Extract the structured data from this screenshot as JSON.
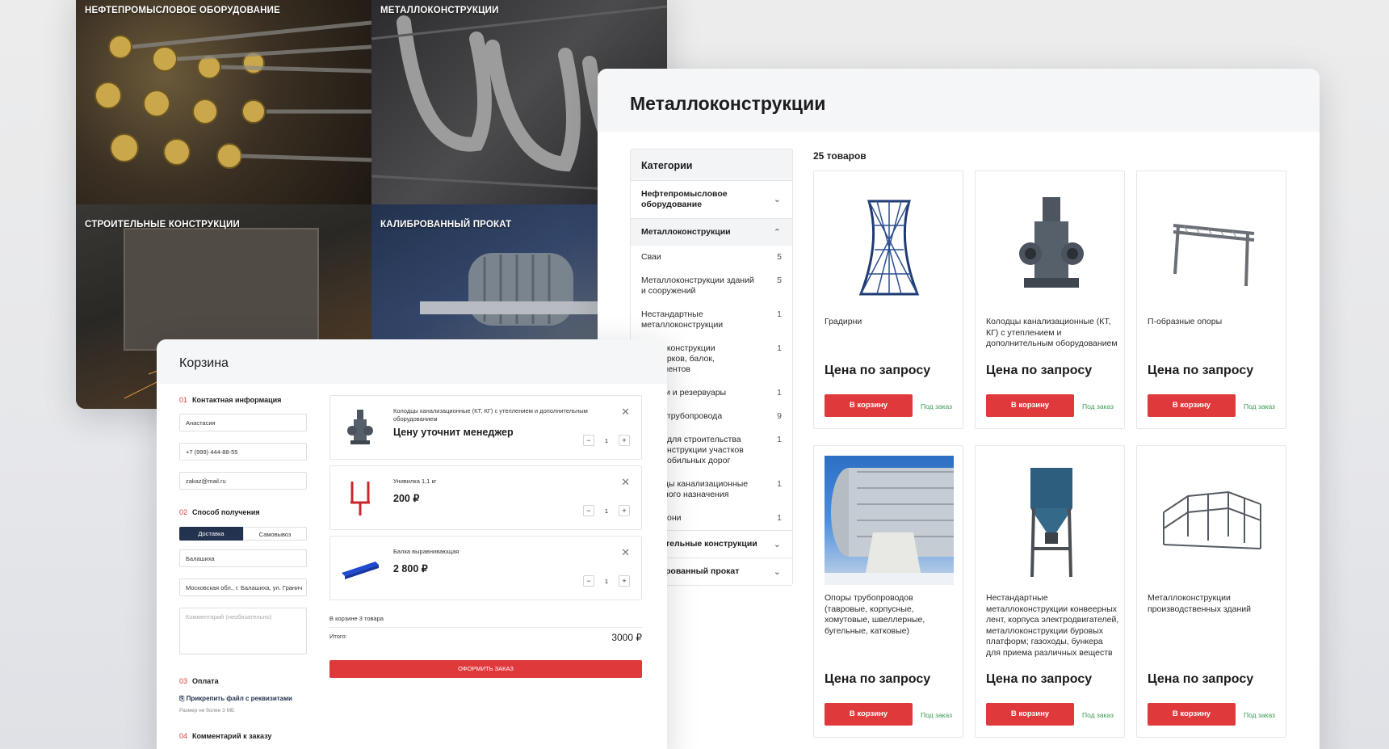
{
  "colors": {
    "accent": "#e0393b",
    "navy": "#23324f",
    "green": "#3a9a52"
  },
  "tiles": [
    {
      "label": "НЕФТЕПРОМЫСЛОВОЕ ОБОРУДОВАНИЕ"
    },
    {
      "label": "МЕТАЛЛОКОНСТРУКЦИИ"
    },
    {
      "label": "СТРОИТЕЛЬНЫЕ КОНСТРУКЦИИ"
    },
    {
      "label": "КАЛИБРОВАННЫЙ ПРОКАТ"
    }
  ],
  "catalog": {
    "title": "Металлоконструкции",
    "sidebar_title": "Категории",
    "groups": [
      {
        "label": "Нефтепромысловое оборудование",
        "icon": "chevron-down-icon"
      },
      {
        "label": "Металлоконструкции",
        "icon": "chevron-up-icon"
      },
      {
        "label": "тельные конструкции",
        "icon": "chevron-down-icon"
      },
      {
        "label": "рованный прокат",
        "icon": "chevron-down-icon"
      }
    ],
    "subs": [
      {
        "label": "Сваи",
        "count": "5"
      },
      {
        "label": "Металлоконструкции зданий и сооружений",
        "count": "5"
      },
      {
        "label": "Нестандартные металлоконструкции",
        "count": "1"
      },
      {
        "label": "оконструкции ерков, балок, ментов",
        "count": "1"
      },
      {
        "label": "и и резервуары",
        "count": "1"
      },
      {
        "label": "трубопровода",
        "count": "9"
      },
      {
        "label": "для строительства нструкции участков обильных дорог",
        "count": "1"
      },
      {
        "label": "цы канализационные ного назначения",
        "count": "1"
      },
      {
        "label": "они",
        "count": "1"
      }
    ],
    "count_label": "25 товаров",
    "products": [
      {
        "name": "Градирни",
        "price": "Цена по запросу",
        "btn": "В корзину",
        "order": "Под заказ"
      },
      {
        "name": "Колодцы канализационные (КТ, КГ) с утеплением и дополнительным оборудованием",
        "price": "Цена по запросу",
        "btn": "В корзину",
        "order": "Под заказ"
      },
      {
        "name": "П-образные опоры",
        "price": "Цена по запросу",
        "btn": "В корзину",
        "order": "Под заказ"
      },
      {
        "name": "Опоры трубопроводов (тавровые, корпусные, хомутовые, швеллерные, бугельные, катковые)",
        "price": "Цена по запросу",
        "btn": "В корзину",
        "order": "Под заказ"
      },
      {
        "name": "Нестандартные металлоконструкции конвеерных лент, корпуса электродвигателей, металлоконструкции буровых платформ; газоходы, бункера для приема различных веществ",
        "price": "Цена по запросу",
        "btn": "В корзину",
        "order": "Под заказ"
      },
      {
        "name": "Металлоконструкции производственных зданий",
        "price": "Цена по запросу",
        "btn": "В корзину",
        "order": "Под заказ"
      }
    ]
  },
  "cart": {
    "title": "Корзина",
    "s1": {
      "n": "01",
      "label": "Контактная информация"
    },
    "name_value": "Анастасия",
    "phone_value": "+7 (999) 444-88-55",
    "email_value": "zakaz@mail.ru",
    "s2": {
      "n": "02",
      "label": "Способ получения"
    },
    "tab_delivery": "Доставка",
    "tab_pickup": "Самовывоз",
    "city_value": "Балашиха",
    "address_value": "Московская обл., г. Балашиха, ул. Гранич",
    "comment_placeholder": "Комментарий (необязательно)",
    "s3": {
      "n": "03",
      "label": "Оплата"
    },
    "attach_label": "Прикрепить файл с реквизитами",
    "attach_note": "Размер не более 3 МБ",
    "s4": {
      "n": "04",
      "label": "Комментарий к заказу"
    },
    "items": [
      {
        "name": "Колодцы канализационные (КТ, КГ) с утеплением и дополнительным оборудованием",
        "price": "Цену уточнит менеджер",
        "qty": "1"
      },
      {
        "name": "Унивилка 1,1 кг",
        "price": "200 ₽",
        "qty": "1"
      },
      {
        "name": "Балка выравнивающая",
        "price": "2 800 ₽",
        "qty": "1"
      }
    ],
    "summary": "В корзине 3 товара",
    "total_label": "Итого:",
    "total_value": "3000 ₽",
    "checkout": "ОФОРМИТЬ ЗАКАЗ"
  }
}
